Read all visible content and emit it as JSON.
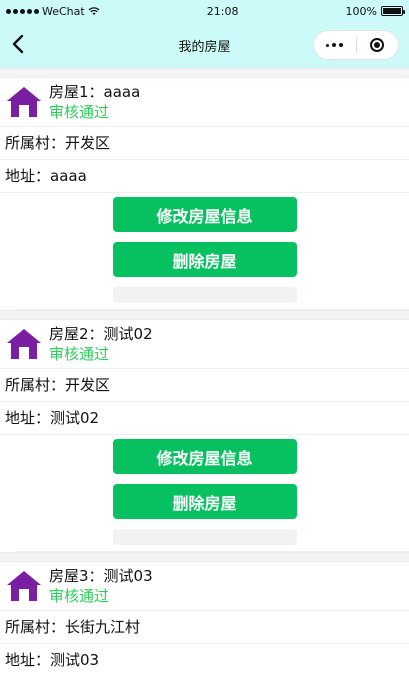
{
  "status_bar": {
    "carrier": "WeChat",
    "time": "21:08",
    "battery": "100%"
  },
  "nav": {
    "title": "我的房屋"
  },
  "colors": {
    "nav_bg": "#ccfaf8",
    "button_green": "#07c160",
    "status_green": "#2ad05a",
    "house_icon": "#7b1fa2"
  },
  "houses": [
    {
      "title": "房屋1：aaaa",
      "status": "审核通过",
      "village": "所属村：开发区",
      "address": "地址：aaaa",
      "edit_label": "修改房屋信息",
      "delete_label": "删除房屋"
    },
    {
      "title": "房屋2：测试02",
      "status": "审核通过",
      "village": "所属村：开发区",
      "address": "地址：测试02",
      "edit_label": "修改房屋信息",
      "delete_label": "删除房屋"
    },
    {
      "title": "房屋3：测试03",
      "status": "审核通过",
      "village": "所属村：长街九江村",
      "address": "地址：测试03"
    }
  ],
  "icons": {
    "back": "chevron-left-icon",
    "more": "more-dots-icon",
    "close": "target-icon",
    "house": "house-icon",
    "wifi": "wifi-icon",
    "battery": "battery-icon"
  }
}
